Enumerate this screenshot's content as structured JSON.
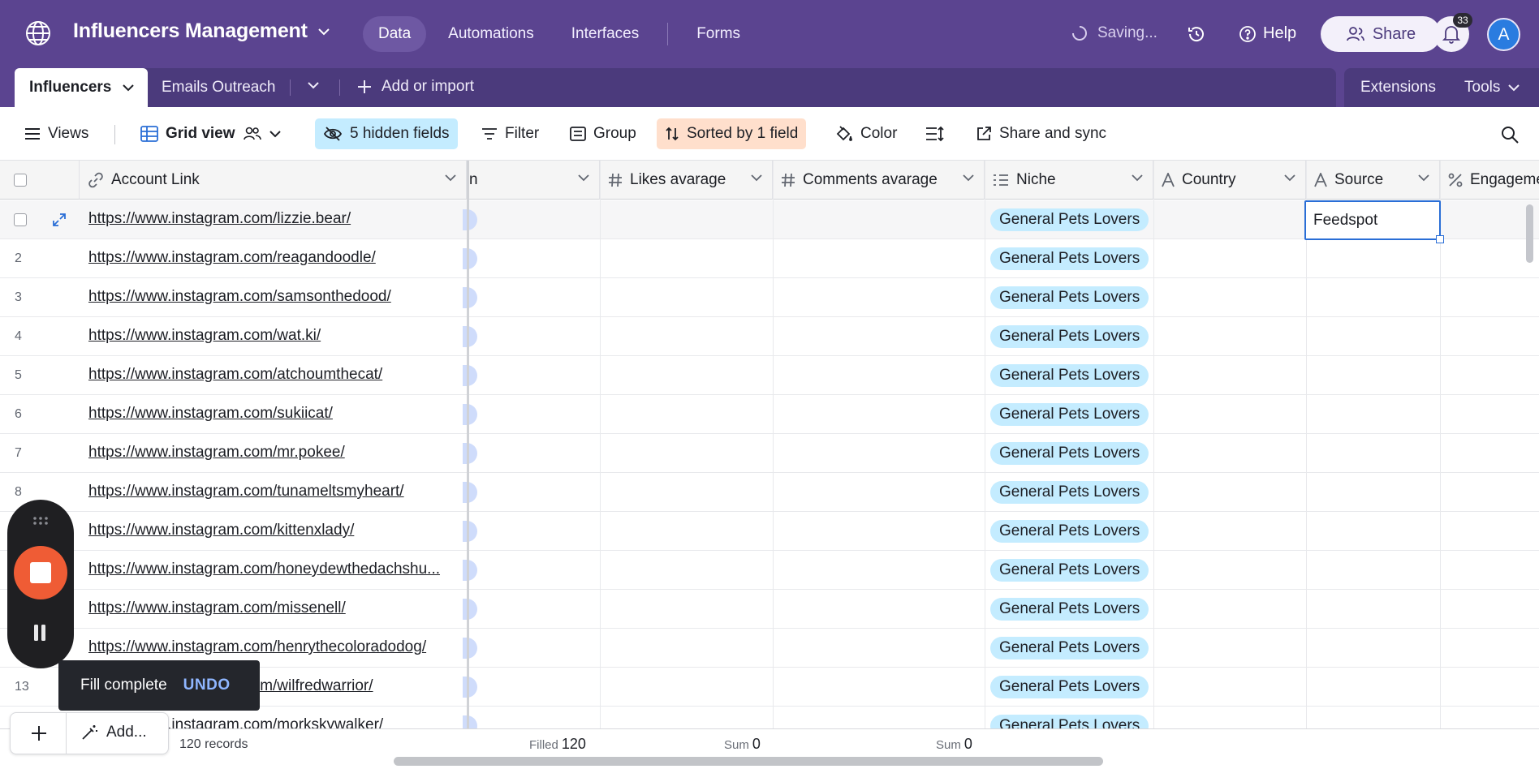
{
  "header": {
    "base_title": "Influencers Management",
    "nav": [
      "Data",
      "Automations",
      "Interfaces",
      "Forms"
    ],
    "saving_text": "Saving...",
    "help_label": "Help",
    "share_label": "Share",
    "notification_count": "33",
    "avatar_initial": "A"
  },
  "tables": {
    "active_tab": "Influencers",
    "other_tab": "Emails Outreach",
    "add_import_label": "Add or import",
    "extensions_label": "Extensions",
    "tools_label": "Tools"
  },
  "viewbar": {
    "views_label": "Views",
    "view_name": "Grid view",
    "hidden_fields_label": "5 hidden fields",
    "filter_label": "Filter",
    "group_label": "Group",
    "sorted_label": "Sorted by 1 field",
    "color_label": "Color",
    "share_sync_label": "Share and sync"
  },
  "columns": {
    "account_link": "Account Link",
    "partial": "n",
    "likes": "Likes avarage",
    "comments": "Comments avarage",
    "niche": "Niche",
    "country": "Country",
    "source": "Source",
    "engagement": "Engageme"
  },
  "rows": [
    {
      "num": "",
      "link": "https://www.instagram.com/lizzie.bear/",
      "niche": "General Pets Lovers"
    },
    {
      "num": "2",
      "link": "https://www.instagram.com/reagandoodle/",
      "niche": "General Pets Lovers"
    },
    {
      "num": "3",
      "link": "https://www.instagram.com/samsonthedood/",
      "niche": "General Pets Lovers"
    },
    {
      "num": "4",
      "link": "https://www.instagram.com/wat.ki/",
      "niche": "General Pets Lovers"
    },
    {
      "num": "5",
      "link": "https://www.instagram.com/atchoumthecat/",
      "niche": "General Pets Lovers"
    },
    {
      "num": "6",
      "link": "https://www.instagram.com/sukiicat/",
      "niche": "General Pets Lovers"
    },
    {
      "num": "7",
      "link": "https://www.instagram.com/mr.pokee/",
      "niche": "General Pets Lovers"
    },
    {
      "num": "8",
      "link": "https://www.instagram.com/tunameltsmyheart/",
      "niche": "General Pets Lovers"
    },
    {
      "num": "",
      "link": "https://www.instagram.com/kittenxlady/",
      "niche": "General Pets Lovers"
    },
    {
      "num": "",
      "link": "https://www.instagram.com/honeydewthedachshu...",
      "niche": "General Pets Lovers"
    },
    {
      "num": "",
      "link": "https://www.instagram.com/missenell/",
      "niche": "General Pets Lovers"
    },
    {
      "num": "",
      "link": "https://www.instagram.com/henrythecoloradodog/",
      "niche": "General Pets Lovers"
    },
    {
      "num": "13",
      "link": "https://www.instagram.com/wilfredwarrior/",
      "niche": "General Pets Lovers"
    },
    {
      "num": "",
      "link": "https://www.instagram.com/morkskywalker/",
      "niche": "General Pets Lovers"
    }
  ],
  "selected_cell_value": "Feedspot",
  "footer": {
    "records": "120 records",
    "filled_label": "Filled",
    "filled_value": "120",
    "sum1_label": "Sum",
    "sum1_value": "0",
    "sum2_label": "Sum",
    "sum2_value": "0",
    "add_label": "Add..."
  },
  "toast": {
    "message": "Fill complete",
    "action": "UNDO"
  },
  "colors": {
    "header_bg": "#5b4490",
    "pill_bg": "#c4ecff",
    "sorted_bg": "#ffdfcc",
    "selection": "#2a6ed6",
    "record_stop": "#ef5c35"
  }
}
